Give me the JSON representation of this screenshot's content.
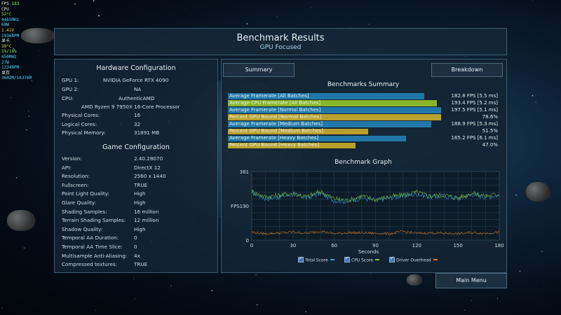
{
  "overlay": {
    "fps": "FPS",
    "fps_value": "183",
    "lines": [
      {
        "text": "CPU",
        "cls": "o-label"
      },
      {
        "text": "52°C",
        "cls": "o-green"
      },
      {
        "text": "4465MHz",
        "cls": "o-cyan"
      },
      {
        "text": "60W",
        "cls": "o-cyan"
      },
      {
        "text": "1.41V",
        "cls": "o-yellow"
      },
      {
        "text": "1936RPM",
        "cls": "o-cyan"
      },
      {
        "text": "显卡",
        "cls": "o-label"
      },
      {
        "text": "39°C",
        "cls": "o-yellow"
      },
      {
        "text": "1%/19%",
        "cls": "o-green"
      },
      {
        "text": "450MHz",
        "cls": "o-cyan"
      },
      {
        "text": "27W",
        "cls": "o-cyan"
      },
      {
        "text": "1234RPM",
        "cls": "o-cyan"
      },
      {
        "text": "显存",
        "cls": "o-label"
      },
      {
        "text": "3602M/16376M",
        "cls": "o-cyan"
      }
    ]
  },
  "header": {
    "title": "Benchmark Results",
    "subtitle": "GPU Focused"
  },
  "hardware": {
    "title": "Hardware Configuration",
    "gpu1_label": "GPU 1:",
    "gpu1_value": "NVIDIA GeForce RTX 4090",
    "gpu2_label": "GPU 2:",
    "gpu2_value": "NA",
    "cpu_label": "CPU:",
    "cpu_value": "AuthenticAMD",
    "cpu_model": "AMD Ryzen 9 7950X 16-Core Processor",
    "phys_cores_label": "Physical Cores:",
    "phys_cores_value": "16",
    "log_cores_label": "Logical Cores:",
    "log_cores_value": "32",
    "mem_label": "Physical Memory:",
    "mem_value": "31891 MB"
  },
  "game": {
    "title": "Game Configuration",
    "items": [
      {
        "key": "Version:",
        "value": "2.40.28070"
      },
      {
        "key": "API:",
        "value": "DirectX 12"
      },
      {
        "key": "Resolution:",
        "value": "2560 x 1440"
      },
      {
        "key": "Fullscreen:",
        "value": "TRUE"
      },
      {
        "key": "Point Light Quality:",
        "value": "High"
      },
      {
        "key": "Glare Quality:",
        "value": "High"
      },
      {
        "key": "Shading Samples:",
        "value": "16 million"
      },
      {
        "key": "Terrain Shading Samples:",
        "value": "12 million"
      },
      {
        "key": "Shadow Quality:",
        "value": "High"
      },
      {
        "key": "Temporal AA Duration:",
        "value": "0"
      },
      {
        "key": "Temporal AA Time Slice:",
        "value": "0"
      },
      {
        "key": "Multisample Anti-Aliasing:",
        "value": "4x"
      },
      {
        "key": "Compressed textures:",
        "value": "TRUE"
      }
    ]
  },
  "tabs": {
    "summary": "Summary",
    "breakdown": "Breakdown"
  },
  "summary": {
    "title": "Benchmarks Summary",
    "bars": [
      {
        "label": "Average Framerate [All Batches]",
        "value": "182.8 FPS [5.5 ms]",
        "fraction": 0.7,
        "color": "#2178a8"
      },
      {
        "label": "Average CPU Framerate [All Batches]",
        "value": "193.4 FPS [5.2 ms]",
        "fraction": 0.745,
        "color": "#8ab529"
      },
      {
        "label": "Average Framerate [Normal Batches]",
        "value": "197.5 FPS [5.1 ms]",
        "fraction": 0.76,
        "color": "#2178a8"
      },
      {
        "label": "Percent GPU Bound [Normal Batches]",
        "value": "78.6%",
        "fraction": 0.76,
        "color": "#b8a02c"
      },
      {
        "label": "Average Framerate [Medium Batches]",
        "value": "188.9 FPS [5.3 ms]",
        "fraction": 0.725,
        "color": "#2178a8"
      },
      {
        "label": "Percent GPU Bound [Medium Batches]",
        "value": "51.5%",
        "fraction": 0.5,
        "color": "#b8a02c"
      },
      {
        "label": "Average Framerate [Heavy Batches]",
        "value": "165.2 FPS [6.1 ms]",
        "fraction": 0.635,
        "color": "#2178a8"
      },
      {
        "label": "Percent GPU Bound [Heavy Batches]",
        "value": "47.0%",
        "fraction": 0.455,
        "color": "#b8a02c"
      }
    ]
  },
  "graph": {
    "title": "Benchmark Graph",
    "ylabel": "FPS",
    "xlabel": "Seconds",
    "ymax_label": "381",
    "ymid_label": "190",
    "ymin_label": "0",
    "xticks": [
      "0",
      "30",
      "60",
      "90",
      "120",
      "150",
      "180"
    ],
    "legend": [
      {
        "label": "Total Score",
        "color": "#2aa0d8"
      },
      {
        "label": "CPU Score",
        "color": "#7ec040"
      },
      {
        "label": "Driver Overhead",
        "color": "#e07a1a"
      }
    ]
  },
  "chart_data": {
    "type": "line",
    "title": "Benchmark Graph",
    "xlabel": "Seconds",
    "ylabel": "FPS",
    "xlim": [
      0,
      180
    ],
    "ylim": [
      0,
      381
    ],
    "x": [
      0,
      10,
      20,
      30,
      40,
      50,
      60,
      70,
      80,
      90,
      100,
      110,
      120,
      130,
      140,
      150,
      160,
      170,
      180
    ],
    "series": [
      {
        "name": "Total Score",
        "values": [
          265,
          230,
          240,
          255,
          235,
          260,
          220,
          215,
          235,
          220,
          235,
          245,
          255,
          240,
          245,
          230,
          255,
          240,
          250
        ]
      },
      {
        "name": "CPU Score",
        "values": [
          270,
          240,
          250,
          260,
          240,
          270,
          230,
          220,
          245,
          225,
          240,
          250,
          265,
          245,
          250,
          235,
          260,
          245,
          255
        ]
      },
      {
        "name": "Driver Overhead",
        "values": [
          45,
          35,
          40,
          45,
          38,
          50,
          35,
          42,
          40,
          38,
          35,
          48,
          38,
          40,
          38,
          36,
          42,
          38,
          45
        ]
      }
    ]
  },
  "footer": {
    "main_menu": "Main Menu"
  }
}
